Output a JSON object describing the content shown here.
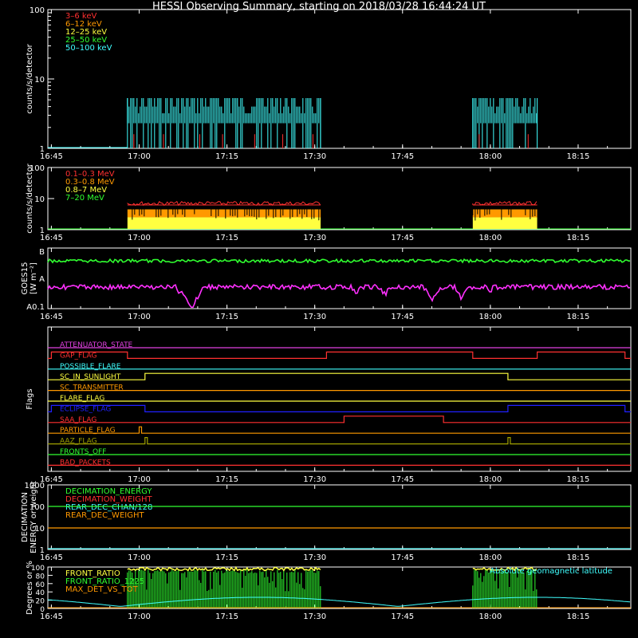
{
  "title": "HESSI Observing Summary, starting on 2018/03/28 16:44:24 UT",
  "time_ticks": [
    "16:45",
    "17:00",
    "17:15",
    "17:30",
    "17:45",
    "18:00",
    "18:15"
  ],
  "chart_data": [
    {
      "id": "countrate",
      "type": "line",
      "ylabel": "counts/s/detector",
      "yscale": "log",
      "yticks": [
        "1",
        "10",
        "100"
      ],
      "ylim": [
        1,
        100
      ],
      "legend": [
        {
          "label": "3–6 keV",
          "color": "#ff3030"
        },
        {
          "label": "6–12 keV",
          "color": "#ff9900"
        },
        {
          "label": "12–25 keV",
          "color": "#ffff40"
        },
        {
          "label": "25–50 keV",
          "color": "#30ff30"
        },
        {
          "label": "50–100 keV",
          "color": "#40ffff"
        }
      ],
      "segments": [
        {
          "start": "16:58",
          "end": "17:31",
          "level": 4.0
        },
        {
          "start": "17:57",
          "end": "18:08",
          "level": 4.0
        }
      ]
    },
    {
      "id": "countrate_high",
      "type": "line",
      "ylabel": "counts/s/detector",
      "yscale": "log",
      "yticks": [
        "1",
        "10",
        "100"
      ],
      "ylim": [
        1,
        100
      ],
      "legend": [
        {
          "label": "0.1–0.3 MeV",
          "color": "#ff3030"
        },
        {
          "label": "0.3–0.8 MeV",
          "color": "#ff9900"
        },
        {
          "label": "0.8–7 MeV",
          "color": "#ffff40"
        },
        {
          "label": "7–20 MeV",
          "color": "#30ff30"
        }
      ],
      "series_levels": [
        {
          "name": "0.1–0.3 MeV",
          "color": "#ff3030",
          "value": 7.0
        },
        {
          "name": "0.3–0.8 MeV",
          "color": "#ff9900",
          "value": 4.5
        },
        {
          "name": "0.8–7 MeV",
          "color": "#ffff40",
          "value": 2.5
        },
        {
          "name": "7–20 MeV",
          "color": "#30ff30",
          "value": 1.0
        }
      ]
    },
    {
      "id": "goes",
      "type": "line",
      "ylabel": "GOES15 [W m⁻²]",
      "yscale": "log",
      "yticks": [
        "A0.1",
        "A",
        "B"
      ],
      "series": [
        {
          "name": "high",
          "color": "#30ff30",
          "level": 0.8
        },
        {
          "name": "low",
          "color": "#ff30ff",
          "level": 0.62
        }
      ]
    },
    {
      "id": "flags",
      "type": "line",
      "ylabel": "Flags",
      "flags": [
        {
          "label": "ATTENUATOR_STATE",
          "color": "#e040e0",
          "ons": []
        },
        {
          "label": "GAP_FLAG",
          "color": "#ff3030",
          "ons": [
            [
              "16:45",
              "16:58"
            ],
            [
              "17:32",
              "17:57"
            ],
            [
              "18:08",
              "18:23"
            ]
          ]
        },
        {
          "label": "POSSIBLE_FLARE",
          "color": "#40ffff",
          "ons": []
        },
        {
          "label": "SC_IN_SUNLIGHT",
          "color": "#ffff40",
          "ons": [
            [
              "17:01",
              "18:03"
            ]
          ]
        },
        {
          "label": "SC_TRANSMITTER",
          "color": "#ff9900",
          "ons": []
        },
        {
          "label": "FLARE_FLAG",
          "color": "#ffff40",
          "ons": []
        },
        {
          "label": "ECLIPSE_FLAG",
          "color": "#2020ff",
          "ons": [
            [
              "16:45",
              "17:01"
            ],
            [
              "18:03",
              "18:23"
            ]
          ]
        },
        {
          "label": "SAA_FLAG",
          "color": "#ff3030",
          "ons": [
            [
              "17:35",
              "17:52"
            ]
          ]
        },
        {
          "label": "PARTICLE_FLAG",
          "color": "#ff9900",
          "ons": [
            [
              "17:00",
              "17:00"
            ]
          ]
        },
        {
          "label": "AAZ_FLAG",
          "color": "#a0a000",
          "ons": [
            [
              "17:01",
              "17:01"
            ],
            [
              "18:03",
              "18:03"
            ]
          ]
        },
        {
          "label": "FRONTS_OFF",
          "color": "#30ff30",
          "ons": []
        },
        {
          "label": "BAD_PACKETS",
          "color": "#ff3030",
          "ons": []
        }
      ]
    },
    {
      "id": "decimation",
      "type": "line",
      "ylabel": "DECIMATION ENERGY or weight",
      "yscale": "log",
      "yticks": [
        "1",
        "10",
        "100",
        "1000"
      ],
      "legend": [
        {
          "label": "DECIMATION_ENERGY",
          "color": "#30ff30",
          "value": 100
        },
        {
          "label": "DECIMATION_WEIGHT",
          "color": "#ff3030",
          "value": 1
        },
        {
          "label": "REAR_DEC_CHAN/128",
          "color": "#40ffff",
          "value": 1
        },
        {
          "label": "REAR_DEC_WEIGHT",
          "color": "#ff9900",
          "value": 10
        }
      ]
    },
    {
      "id": "ratio",
      "type": "line",
      "ylabel": "Degrees or %",
      "yticks": [
        "0",
        "20",
        "40",
        "60",
        "80",
        "100"
      ],
      "ylim": [
        0,
        100
      ],
      "legend": [
        {
          "label": "FRONT_RATIO",
          "color": "#ffff40"
        },
        {
          "label": "FRONT_RATIO_1225",
          "color": "#30ff30"
        },
        {
          "label": "MAX_DET_VS_TOT",
          "color": "#ff9900"
        }
      ],
      "note": "Absolute geomagnetic latitude",
      "note_color": "#40ffff"
    }
  ]
}
